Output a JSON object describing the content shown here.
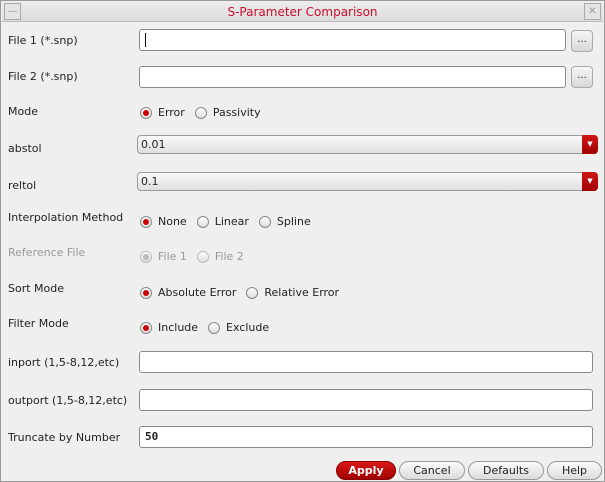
{
  "window": {
    "title": "S-Parameter Comparison",
    "minimize_icon": "minimize-icon",
    "close_icon": "close-icon"
  },
  "file1": {
    "label": "File 1 (*.snp)",
    "value": "",
    "browse": "..."
  },
  "file2": {
    "label": "File 2 (*.snp)",
    "value": "",
    "browse": "..."
  },
  "mode": {
    "label": "Mode",
    "options": [
      "Error",
      "Passivity"
    ],
    "selected": "Error"
  },
  "abstol": {
    "label": "abstol",
    "value": "0.01"
  },
  "reltol": {
    "label": "reltol",
    "value": "0.1"
  },
  "interpolation": {
    "label": "Interpolation Method",
    "options": [
      "None",
      "Linear",
      "Spline"
    ],
    "selected": "None"
  },
  "reference": {
    "label": "Reference File",
    "options": [
      "File 1",
      "File 2"
    ],
    "selected": "File 1",
    "disabled": true
  },
  "sort": {
    "label": "Sort Mode",
    "options": [
      "Absolute Error",
      "Relative Error"
    ],
    "selected": "Absolute Error"
  },
  "filter": {
    "label": "Filter Mode",
    "options": [
      "Include",
      "Exclude"
    ],
    "selected": "Include"
  },
  "inport": {
    "label": "inport (1,5-8,12,etc)",
    "value": ""
  },
  "outport": {
    "label": "outport (1,5-8,12,etc)",
    "value": ""
  },
  "truncate": {
    "label": "Truncate by Number",
    "value": "50"
  },
  "buttons": {
    "apply": "Apply",
    "cancel": "Cancel",
    "defaults": "Defaults",
    "help": "Help"
  },
  "colors": {
    "accent": "#c00000",
    "title": "#c8102e"
  }
}
